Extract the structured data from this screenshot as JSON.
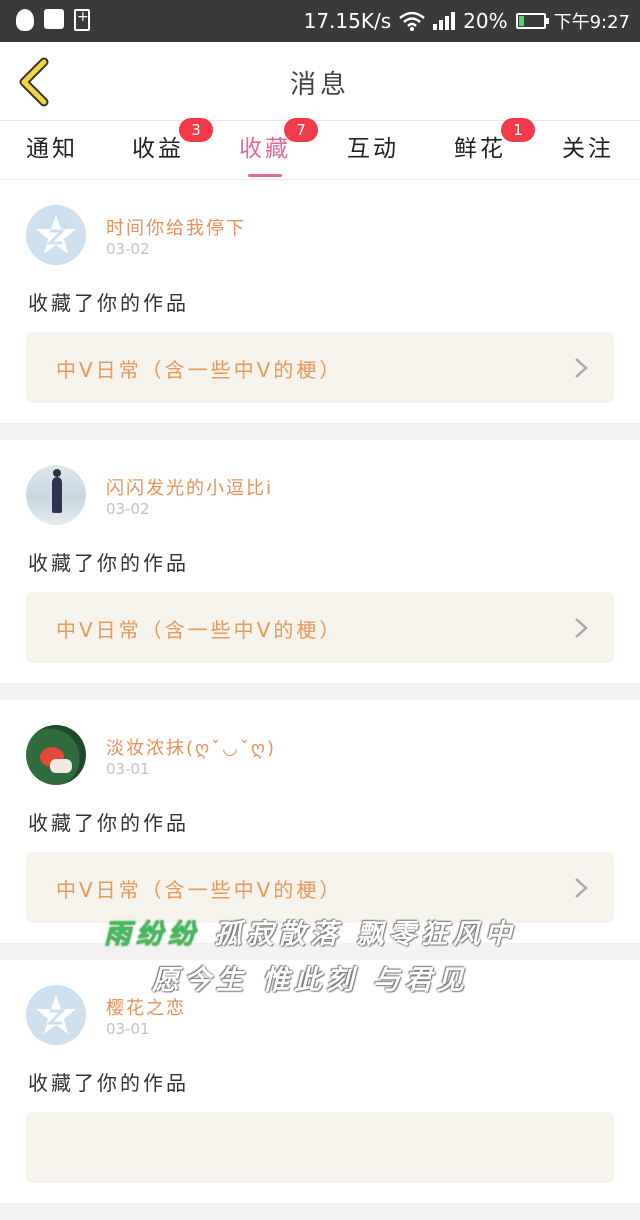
{
  "status_bar": {
    "net_speed": "17.15K/s",
    "battery_percent": "20%",
    "battery_level": 0.2,
    "time": "下午9:27",
    "icons": [
      "qq-icon",
      "camera-icon",
      "battery-add-icon",
      "wifi-icon",
      "signal-icon",
      "battery-icon"
    ]
  },
  "header": {
    "back_icon": "chevron-left-icon",
    "title": "消息"
  },
  "tabs": [
    {
      "label": "通知",
      "badge": ""
    },
    {
      "label": "收益",
      "badge": "3"
    },
    {
      "label": "收藏",
      "badge": "7",
      "active": true
    },
    {
      "label": "互动",
      "badge": ""
    },
    {
      "label": "鲜花",
      "badge": "1"
    },
    {
      "label": "关注",
      "badge": ""
    }
  ],
  "colors": {
    "accent_pink": "#e06c9a",
    "badge_red": "#f23a4a",
    "nick_orange": "#e8905a",
    "link_orange": "#e69a5c",
    "lyric_green": "#3fbe58"
  },
  "items": [
    {
      "nickname": "时间你给我停下",
      "date": "03-02",
      "action": "收藏了你的作品",
      "work": "中V日常（含一些中V的梗）"
    },
    {
      "nickname": "闪闪发光的小逗比i",
      "date": "03-02",
      "action": "收藏了你的作品",
      "work": "中V日常（含一些中V的梗）"
    },
    {
      "nickname": "淡妆浓抹(ღˇ◡ˇღ)",
      "date": "03-01",
      "action": "收藏了你的作品",
      "work": "中V日常（含一些中V的梗）"
    },
    {
      "nickname": "樱花之恋",
      "date": "03-01",
      "action": "收藏了你的作品",
      "work": ""
    }
  ],
  "lyrics": {
    "line1_highlight": "雨纷纷",
    "line1_rest": "孤寂散落 飘零狂风中",
    "line2": "愿今生 惟此刻 与君见"
  }
}
